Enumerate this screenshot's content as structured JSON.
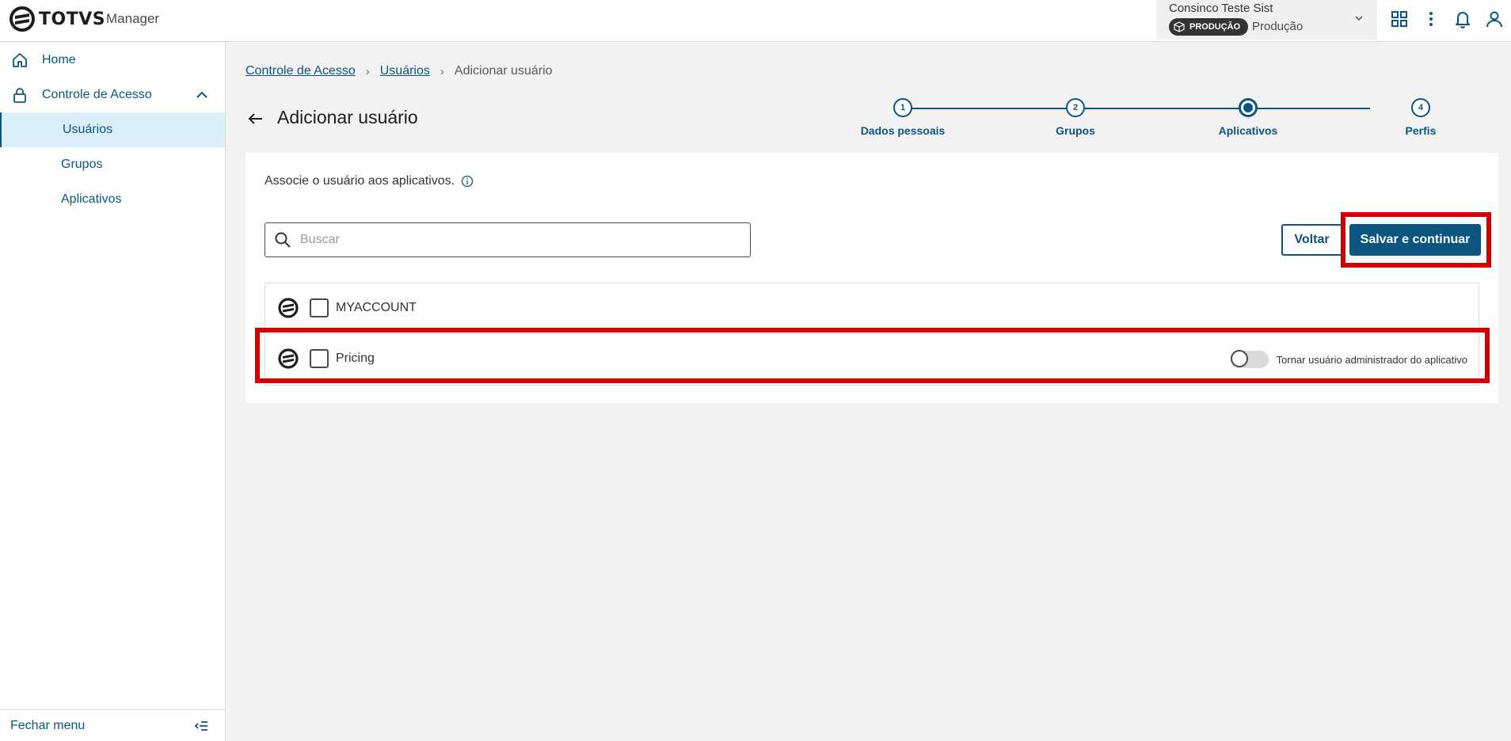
{
  "header": {
    "logo_text": "TOTVS",
    "app_name": "Manager",
    "environment": {
      "company": "Consinco Teste Sist",
      "badge": "PRODUÇÃO",
      "name": "Produção"
    },
    "icons": [
      "apps-grid-icon",
      "more-vertical-icon",
      "bell-icon",
      "user-icon"
    ]
  },
  "sidebar": {
    "items": [
      {
        "label": "Home",
        "icon": "home-icon"
      },
      {
        "label": "Controle de Acesso",
        "icon": "lock-icon",
        "expanded": true
      }
    ],
    "sub_items": [
      {
        "label": "Usuários",
        "active": true
      },
      {
        "label": "Grupos",
        "active": false
      },
      {
        "label": "Aplicativos",
        "active": false
      }
    ],
    "footer_label": "Fechar menu"
  },
  "breadcrumb": {
    "items": [
      "Controle de Acesso",
      "Usuários"
    ],
    "current": "Adicionar usuário"
  },
  "page": {
    "title": "Adicionar usuário"
  },
  "stepper": {
    "steps": [
      {
        "number": "1",
        "label": "Dados pessoais",
        "state": "done"
      },
      {
        "number": "2",
        "label": "Grupos",
        "state": "done"
      },
      {
        "number": "",
        "label": "Aplicativos",
        "state": "current"
      },
      {
        "number": "4",
        "label": "Perfis",
        "state": "pending"
      }
    ]
  },
  "card": {
    "description": "Associe o usuário aos aplicativos.",
    "search_placeholder": "Buscar",
    "search_value": "",
    "back_label": "Voltar",
    "save_label": "Salvar e continuar"
  },
  "apps": [
    {
      "name": "MYACCOUNT",
      "checked": false,
      "has_admin_toggle": false
    },
    {
      "name": "Pricing",
      "checked": false,
      "has_admin_toggle": true,
      "admin_toggle_label": "Tornar usuário administrador do aplicativo",
      "admin_on": false
    }
  ],
  "colors": {
    "primary": "#0c5580",
    "active_bg": "#dbeefa",
    "highlight": "#d10000"
  }
}
